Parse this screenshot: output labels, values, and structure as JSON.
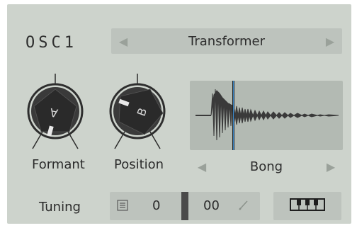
{
  "osc": {
    "title": "OSC1",
    "wavetable": "Transformer",
    "prev_icon": "triangle-left-icon",
    "next_icon": "triangle-right-icon"
  },
  "knobs": {
    "formant_label": "Formant",
    "formant_letter": "A",
    "position_label": "Position",
    "position_letter": "B"
  },
  "sample": {
    "name": "Bong",
    "prev_icon": "triangle-left-icon",
    "next_icon": "triangle-right-icon"
  },
  "tuning": {
    "label": "Tuning",
    "semitones": "0",
    "cents": "00",
    "menu_icon": "list-icon",
    "edit_icon": "pencil-icon",
    "keyboard_icon": "piano-keyboard-icon"
  },
  "colors": {
    "panel": "#cdd3cc",
    "field": "#bdc3bd",
    "knob": "#2d2d2d",
    "marker": "#3e88c8"
  }
}
